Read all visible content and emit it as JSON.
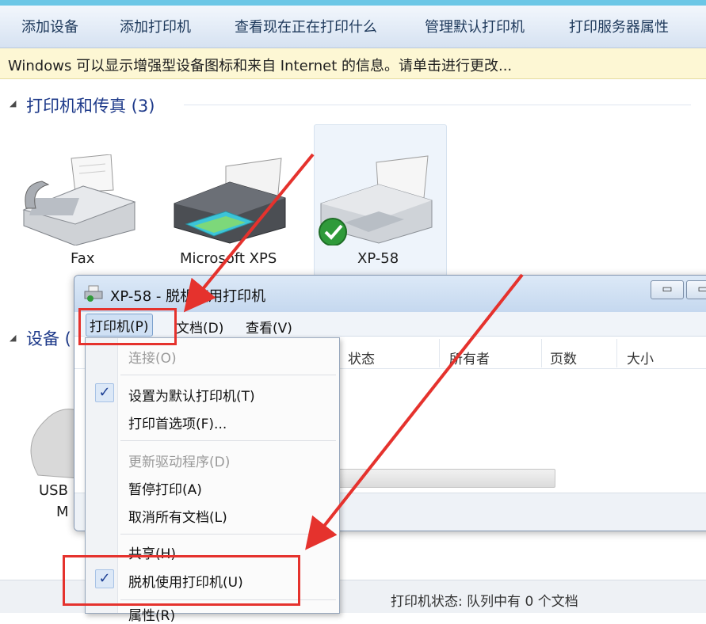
{
  "toolbar": {
    "add_device": "添加设备",
    "add_printer": "添加打印机",
    "see_printing": "查看现在正在打印什么",
    "manage_default": "管理默认打印机",
    "server_props": "打印服务器属性"
  },
  "infobar": {
    "text": "Windows 可以显示增强型设备图标和来自 Internet 的信息。请单击进行更改..."
  },
  "groups": {
    "printers_header": "打印机和传真 (3)",
    "devices_header": "设备 ("
  },
  "devices": {
    "fax": "Fax",
    "xps": "Microsoft XPS",
    "xp58": "XP-58",
    "usb_line1": "USB",
    "usb_line2": "M"
  },
  "queue_window": {
    "title": "XP-58  -  脱机使用打印机",
    "min_symbol": "▭",
    "max_symbol": "▭",
    "menu": {
      "printer": "打印机(P)",
      "document": "文档(D)",
      "view": "查看(V)"
    },
    "columns": [
      "状态",
      "所有者",
      "页数",
      "大小"
    ]
  },
  "dropdown": {
    "connect": "连接(O)",
    "set_default": "设置为默认打印机(T)",
    "preferences": "打印首选项(F)...",
    "update_driver": "更新驱动程序(D)",
    "pause": "暂停打印(A)",
    "cancel_all": "取消所有文档(L)",
    "share": "共享(H)",
    "offline": "脱机使用打印机(U)",
    "properties": "属性(R)",
    "check_symbol": "✓"
  },
  "statusbar": {
    "text": "打印机状态: 队列中有 0 个文档"
  },
  "colors": {
    "annotation_red": "#e5322d",
    "link_blue": "#1e3a8a"
  },
  "icons": {
    "fax": "fax-machine-icon",
    "xps": "printer-icon",
    "xp58": "printer-default-check-icon"
  }
}
